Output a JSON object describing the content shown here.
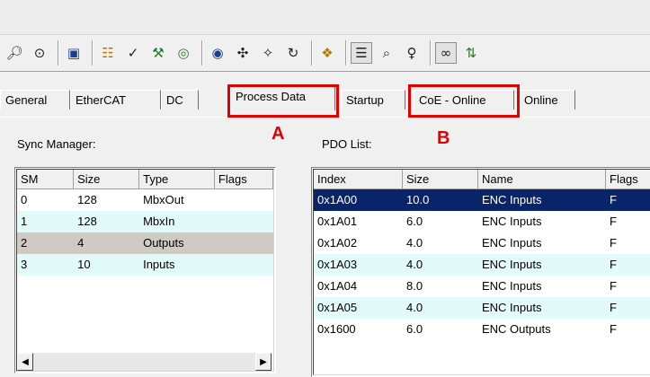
{
  "toolbar": {
    "icons": [
      "binoculars-icon",
      "alarm-icon",
      "monitor-icon",
      "network-scan-icon",
      "check-icon",
      "build-icon",
      "target-icon",
      "activate-icon",
      "route-icon",
      "scan-icon",
      "reload-icon",
      "map-icon",
      "document-icon",
      "zoom-icon",
      "variable-icon",
      "glasses-icon",
      "arrows-icon"
    ]
  },
  "tabs": {
    "general": "General",
    "ethercat": "EtherCAT",
    "dc": "DC",
    "process_data": "Process Data",
    "startup": "Startup",
    "coe_online": "CoE - Online",
    "online": "Online"
  },
  "annotations": {
    "a": "A",
    "b": "B"
  },
  "sync_manager": {
    "label": "Sync Manager:",
    "columns": {
      "sm": "SM",
      "size": "Size",
      "type": "Type",
      "flags": "Flags"
    },
    "rows": [
      {
        "sm": "0",
        "size": "128",
        "type": "MbxOut",
        "flags": ""
      },
      {
        "sm": "1",
        "size": "128",
        "type": "MbxIn",
        "flags": ""
      },
      {
        "sm": "2",
        "size": "4",
        "type": "Outputs",
        "flags": ""
      },
      {
        "sm": "3",
        "size": "10",
        "type": "Inputs",
        "flags": ""
      }
    ]
  },
  "pdo_list": {
    "label": "PDO List:",
    "columns": {
      "index": "Index",
      "size": "Size",
      "name": "Name",
      "flags": "Flags"
    },
    "rows": [
      {
        "index": "0x1A00",
        "size": "10.0",
        "name": "ENC Inputs",
        "flags": "F"
      },
      {
        "index": "0x1A01",
        "size": "6.0",
        "name": "ENC Inputs",
        "flags": "F"
      },
      {
        "index": "0x1A02",
        "size": "4.0",
        "name": "ENC Inputs",
        "flags": "F"
      },
      {
        "index": "0x1A03",
        "size": "4.0",
        "name": "ENC Inputs",
        "flags": "F"
      },
      {
        "index": "0x1A04",
        "size": "8.0",
        "name": "ENC Inputs",
        "flags": "F"
      },
      {
        "index": "0x1A05",
        "size": "4.0",
        "name": "ENC Inputs",
        "flags": "F"
      },
      {
        "index": "0x1600",
        "size": "6.0",
        "name": "ENC Outputs",
        "flags": "F"
      }
    ]
  },
  "colors": {
    "highlight": "#e00000",
    "selection": "#0a246a",
    "row_alt": "#e3fafa"
  }
}
